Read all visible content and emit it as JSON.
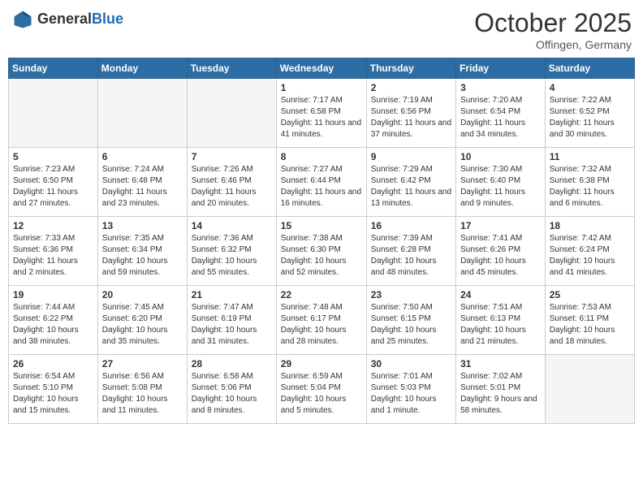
{
  "header": {
    "logo_general": "General",
    "logo_blue": "Blue",
    "month": "October 2025",
    "location": "Offingen, Germany"
  },
  "weekdays": [
    "Sunday",
    "Monday",
    "Tuesday",
    "Wednesday",
    "Thursday",
    "Friday",
    "Saturday"
  ],
  "weeks": [
    [
      {
        "day": "",
        "sunrise": "",
        "sunset": "",
        "daylight": "",
        "empty": true
      },
      {
        "day": "",
        "sunrise": "",
        "sunset": "",
        "daylight": "",
        "empty": true
      },
      {
        "day": "",
        "sunrise": "",
        "sunset": "",
        "daylight": "",
        "empty": true
      },
      {
        "day": "1",
        "sunrise": "Sunrise: 7:17 AM",
        "sunset": "Sunset: 6:58 PM",
        "daylight": "Daylight: 11 hours and 41 minutes."
      },
      {
        "day": "2",
        "sunrise": "Sunrise: 7:19 AM",
        "sunset": "Sunset: 6:56 PM",
        "daylight": "Daylight: 11 hours and 37 minutes."
      },
      {
        "day": "3",
        "sunrise": "Sunrise: 7:20 AM",
        "sunset": "Sunset: 6:54 PM",
        "daylight": "Daylight: 11 hours and 34 minutes."
      },
      {
        "day": "4",
        "sunrise": "Sunrise: 7:22 AM",
        "sunset": "Sunset: 6:52 PM",
        "daylight": "Daylight: 11 hours and 30 minutes."
      }
    ],
    [
      {
        "day": "5",
        "sunrise": "Sunrise: 7:23 AM",
        "sunset": "Sunset: 6:50 PM",
        "daylight": "Daylight: 11 hours and 27 minutes."
      },
      {
        "day": "6",
        "sunrise": "Sunrise: 7:24 AM",
        "sunset": "Sunset: 6:48 PM",
        "daylight": "Daylight: 11 hours and 23 minutes."
      },
      {
        "day": "7",
        "sunrise": "Sunrise: 7:26 AM",
        "sunset": "Sunset: 6:46 PM",
        "daylight": "Daylight: 11 hours and 20 minutes."
      },
      {
        "day": "8",
        "sunrise": "Sunrise: 7:27 AM",
        "sunset": "Sunset: 6:44 PM",
        "daylight": "Daylight: 11 hours and 16 minutes."
      },
      {
        "day": "9",
        "sunrise": "Sunrise: 7:29 AM",
        "sunset": "Sunset: 6:42 PM",
        "daylight": "Daylight: 11 hours and 13 minutes."
      },
      {
        "day": "10",
        "sunrise": "Sunrise: 7:30 AM",
        "sunset": "Sunset: 6:40 PM",
        "daylight": "Daylight: 11 hours and 9 minutes."
      },
      {
        "day": "11",
        "sunrise": "Sunrise: 7:32 AM",
        "sunset": "Sunset: 6:38 PM",
        "daylight": "Daylight: 11 hours and 6 minutes."
      }
    ],
    [
      {
        "day": "12",
        "sunrise": "Sunrise: 7:33 AM",
        "sunset": "Sunset: 6:36 PM",
        "daylight": "Daylight: 11 hours and 2 minutes."
      },
      {
        "day": "13",
        "sunrise": "Sunrise: 7:35 AM",
        "sunset": "Sunset: 6:34 PM",
        "daylight": "Daylight: 10 hours and 59 minutes."
      },
      {
        "day": "14",
        "sunrise": "Sunrise: 7:36 AM",
        "sunset": "Sunset: 6:32 PM",
        "daylight": "Daylight: 10 hours and 55 minutes."
      },
      {
        "day": "15",
        "sunrise": "Sunrise: 7:38 AM",
        "sunset": "Sunset: 6:30 PM",
        "daylight": "Daylight: 10 hours and 52 minutes."
      },
      {
        "day": "16",
        "sunrise": "Sunrise: 7:39 AM",
        "sunset": "Sunset: 6:28 PM",
        "daylight": "Daylight: 10 hours and 48 minutes."
      },
      {
        "day": "17",
        "sunrise": "Sunrise: 7:41 AM",
        "sunset": "Sunset: 6:26 PM",
        "daylight": "Daylight: 10 hours and 45 minutes."
      },
      {
        "day": "18",
        "sunrise": "Sunrise: 7:42 AM",
        "sunset": "Sunset: 6:24 PM",
        "daylight": "Daylight: 10 hours and 41 minutes."
      }
    ],
    [
      {
        "day": "19",
        "sunrise": "Sunrise: 7:44 AM",
        "sunset": "Sunset: 6:22 PM",
        "daylight": "Daylight: 10 hours and 38 minutes."
      },
      {
        "day": "20",
        "sunrise": "Sunrise: 7:45 AM",
        "sunset": "Sunset: 6:20 PM",
        "daylight": "Daylight: 10 hours and 35 minutes."
      },
      {
        "day": "21",
        "sunrise": "Sunrise: 7:47 AM",
        "sunset": "Sunset: 6:19 PM",
        "daylight": "Daylight: 10 hours and 31 minutes."
      },
      {
        "day": "22",
        "sunrise": "Sunrise: 7:48 AM",
        "sunset": "Sunset: 6:17 PM",
        "daylight": "Daylight: 10 hours and 28 minutes."
      },
      {
        "day": "23",
        "sunrise": "Sunrise: 7:50 AM",
        "sunset": "Sunset: 6:15 PM",
        "daylight": "Daylight: 10 hours and 25 minutes."
      },
      {
        "day": "24",
        "sunrise": "Sunrise: 7:51 AM",
        "sunset": "Sunset: 6:13 PM",
        "daylight": "Daylight: 10 hours and 21 minutes."
      },
      {
        "day": "25",
        "sunrise": "Sunrise: 7:53 AM",
        "sunset": "Sunset: 6:11 PM",
        "daylight": "Daylight: 10 hours and 18 minutes."
      }
    ],
    [
      {
        "day": "26",
        "sunrise": "Sunrise: 6:54 AM",
        "sunset": "Sunset: 5:10 PM",
        "daylight": "Daylight: 10 hours and 15 minutes."
      },
      {
        "day": "27",
        "sunrise": "Sunrise: 6:56 AM",
        "sunset": "Sunset: 5:08 PM",
        "daylight": "Daylight: 10 hours and 11 minutes."
      },
      {
        "day": "28",
        "sunrise": "Sunrise: 6:58 AM",
        "sunset": "Sunset: 5:06 PM",
        "daylight": "Daylight: 10 hours and 8 minutes."
      },
      {
        "day": "29",
        "sunrise": "Sunrise: 6:59 AM",
        "sunset": "Sunset: 5:04 PM",
        "daylight": "Daylight: 10 hours and 5 minutes."
      },
      {
        "day": "30",
        "sunrise": "Sunrise: 7:01 AM",
        "sunset": "Sunset: 5:03 PM",
        "daylight": "Daylight: 10 hours and 1 minute."
      },
      {
        "day": "31",
        "sunrise": "Sunrise: 7:02 AM",
        "sunset": "Sunset: 5:01 PM",
        "daylight": "Daylight: 9 hours and 58 minutes."
      },
      {
        "day": "",
        "sunrise": "",
        "sunset": "",
        "daylight": "",
        "empty": true
      }
    ]
  ]
}
